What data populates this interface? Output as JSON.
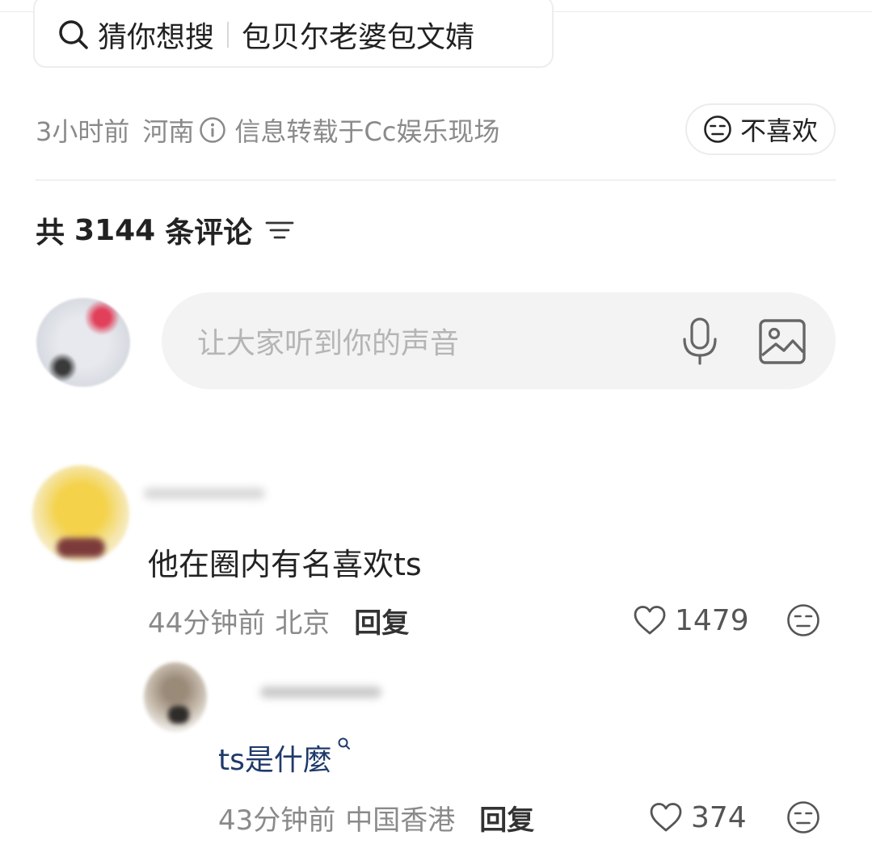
{
  "guess": {
    "label": "猜你想搜",
    "query": "包贝尔老婆包文婧"
  },
  "article_meta": {
    "time": "3小时前",
    "location": "河南",
    "source": "信息转载于Cc娱乐现场",
    "dislike_label": "不喜欢"
  },
  "comments_header": {
    "prefix": "共",
    "count": "3144",
    "suffix": "条评论"
  },
  "composer": {
    "placeholder": "让大家听到你的声音"
  },
  "comments": [
    {
      "text": "他在圈内有名喜欢ts",
      "time": "44分钟前",
      "location": "北京",
      "reply_label": "回复",
      "likes": "1479"
    }
  ],
  "replies": [
    {
      "text": "ts是什麼",
      "time": "43分钟前",
      "location": "中国香港",
      "reply_label": "回复",
      "likes": "374"
    }
  ],
  "icons": [
    "search-icon",
    "info-icon",
    "meh-face-icon",
    "sort-icon",
    "mic-icon",
    "image-icon",
    "heart-icon"
  ]
}
